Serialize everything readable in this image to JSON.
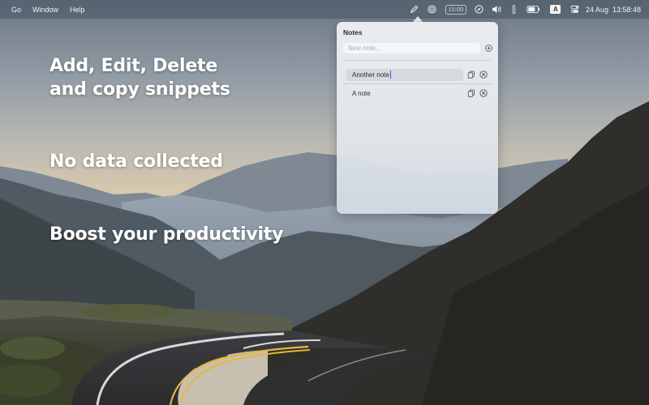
{
  "menubar": {
    "menus": [
      "Go",
      "Window",
      "Help"
    ],
    "icons": [
      "pencil-icon",
      "target-icon",
      "timer-badge",
      "compass-icon",
      "volume-icon",
      "paperclip-icon",
      "battery-icon",
      "input-source-badge",
      "control-center-icon"
    ],
    "timer_text": "15:00",
    "input_source": "A",
    "date": "24 Aug",
    "time": "13:58:48"
  },
  "promo": {
    "line1": "Add, Edit, Delete and copy snippets",
    "line2": "No data collected",
    "line3": "Boost your productivity"
  },
  "popover": {
    "title": "Notes",
    "new_note_placeholder": "New note...",
    "notes": [
      {
        "text": "Another note",
        "editing": true
      },
      {
        "text": "A note",
        "editing": false
      }
    ]
  },
  "colors": {
    "caret": "#2a63d8",
    "road_center_line": "#e7b640"
  }
}
